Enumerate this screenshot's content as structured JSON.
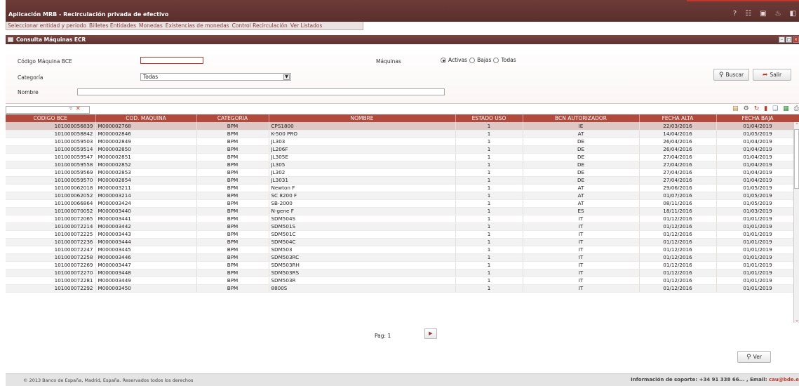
{
  "app": {
    "title": "Aplicación MRB - Recirculación privada de efectivo",
    "header_icons": [
      "help-icon",
      "sitemap-icon",
      "window-icon",
      "bell-icon",
      "exit-icon"
    ]
  },
  "menu": {
    "items": [
      "Seleccionar entidad y periodo",
      "Billetes Entidades",
      "Monedas",
      "Existencias de monedas",
      "Control Recirculación",
      "Ver Listados"
    ]
  },
  "panel": {
    "title": "Consulta Máquinas ECR"
  },
  "filters": {
    "codigo_label": "Código Máquina BCE",
    "codigo_value": "",
    "maquinas_label": "Máquinas",
    "radio_options": [
      "Activas",
      "Bajas",
      "Todas"
    ],
    "radio_selected": "Activas",
    "categoria_label": "Categoría",
    "categoria_value": "Todas",
    "nombre_label": "Nombre",
    "nombre_value": "",
    "buscar_label": "Buscar",
    "salir_label": "Salir"
  },
  "grid": {
    "columns": [
      "CODIGO BCE",
      "COD. MAQUINA",
      "CATEGORIA",
      "NOMBRE",
      "ESTADO USO",
      "BCN AUTORIZADOR",
      "FECHA ALTA",
      "FECHA BAJA"
    ],
    "rows": [
      [
        "101000056839",
        "M000002768",
        "BPM",
        "CPS1800",
        "1",
        "IE",
        "22/03/2016",
        "01/04/2019"
      ],
      [
        "101000058842",
        "M000002846",
        "BPM",
        "K-500 PRO",
        "1",
        "AT",
        "14/04/2016",
        "01/05/2019"
      ],
      [
        "101000059503",
        "M000002849",
        "BPM",
        "JL303",
        "1",
        "DE",
        "26/04/2016",
        "01/04/2019"
      ],
      [
        "101000059514",
        "M000002850",
        "BPM",
        "JL206F",
        "1",
        "DE",
        "26/04/2016",
        "01/04/2019"
      ],
      [
        "101000059547",
        "M000002851",
        "BPM",
        "JL305E",
        "1",
        "DE",
        "27/04/2016",
        "01/04/2019"
      ],
      [
        "101000059558",
        "M000002852",
        "BPM",
        "JL305",
        "1",
        "DE",
        "27/04/2016",
        "01/04/2019"
      ],
      [
        "101000059569",
        "M000002853",
        "BPM",
        "JL302",
        "1",
        "DE",
        "27/04/2016",
        "01/04/2019"
      ],
      [
        "101000059570",
        "M000002854",
        "BPM",
        "JL3031",
        "1",
        "DE",
        "27/04/2016",
        "01/04/2019"
      ],
      [
        "101000062018",
        "M000003211",
        "BPM",
        "Newton F",
        "1",
        "AT",
        "29/06/2016",
        "01/05/2019"
      ],
      [
        "101000062052",
        "M000003214",
        "BPM",
        "SC 8200 F",
        "1",
        "AT",
        "01/07/2016",
        "01/05/2019"
      ],
      [
        "101000066864",
        "M000003424",
        "BPM",
        "SB-2000",
        "1",
        "AT",
        "08/11/2016",
        "01/05/2019"
      ],
      [
        "101000070052",
        "M000003440",
        "BPM",
        "N-gene F",
        "1",
        "ES",
        "18/11/2016",
        "01/03/2019"
      ],
      [
        "101000072065",
        "M000003441",
        "BPM",
        "SDM504S",
        "1",
        "IT",
        "01/12/2016",
        "01/01/2019"
      ],
      [
        "101000072214",
        "M000003442",
        "BPM",
        "SDM501S",
        "1",
        "IT",
        "01/12/2016",
        "01/01/2019"
      ],
      [
        "101000072225",
        "M000003443",
        "BPM",
        "SDM501C",
        "1",
        "IT",
        "01/12/2016",
        "01/01/2019"
      ],
      [
        "101000072236",
        "M000003444",
        "BPM",
        "SDM504C",
        "1",
        "IT",
        "01/12/2016",
        "01/01/2019"
      ],
      [
        "101000072247",
        "M000003445",
        "BPM",
        "SDM503",
        "1",
        "IT",
        "01/12/2016",
        "01/01/2019"
      ],
      [
        "101000072258",
        "M000003446",
        "BPM",
        "SDM503RC",
        "1",
        "IT",
        "01/12/2016",
        "01/01/2019"
      ],
      [
        "101000072269",
        "M000003447",
        "BPM",
        "SDM503RH",
        "1",
        "IT",
        "01/12/2016",
        "01/01/2019"
      ],
      [
        "101000072270",
        "M000003448",
        "BPM",
        "SDM503RS",
        "1",
        "IT",
        "01/12/2016",
        "01/01/2019"
      ],
      [
        "101000072281",
        "M000003449",
        "BPM",
        "SDM503R",
        "1",
        "IT",
        "01/12/2016",
        "01/01/2019"
      ],
      [
        "101000072292",
        "M000003450",
        "BPM",
        "8800S",
        "1",
        "IT",
        "01/12/2016",
        "01/01/2019"
      ]
    ]
  },
  "pager": {
    "label": "Pag: 1"
  },
  "ver_label": "Ver",
  "footer": {
    "copyright": "© 2013 Banco de España, Madrid, España. Reservados todos los derechos",
    "support_prefix": "Información de soporte: +34 91 338 66... , Email:",
    "support_email": "cau@bde.e"
  },
  "colors": {
    "header_bg": "#5e322f",
    "grid_header": "#b14a3d",
    "selected_row": "#ddc8c5",
    "accent_red": "#c0392b"
  }
}
